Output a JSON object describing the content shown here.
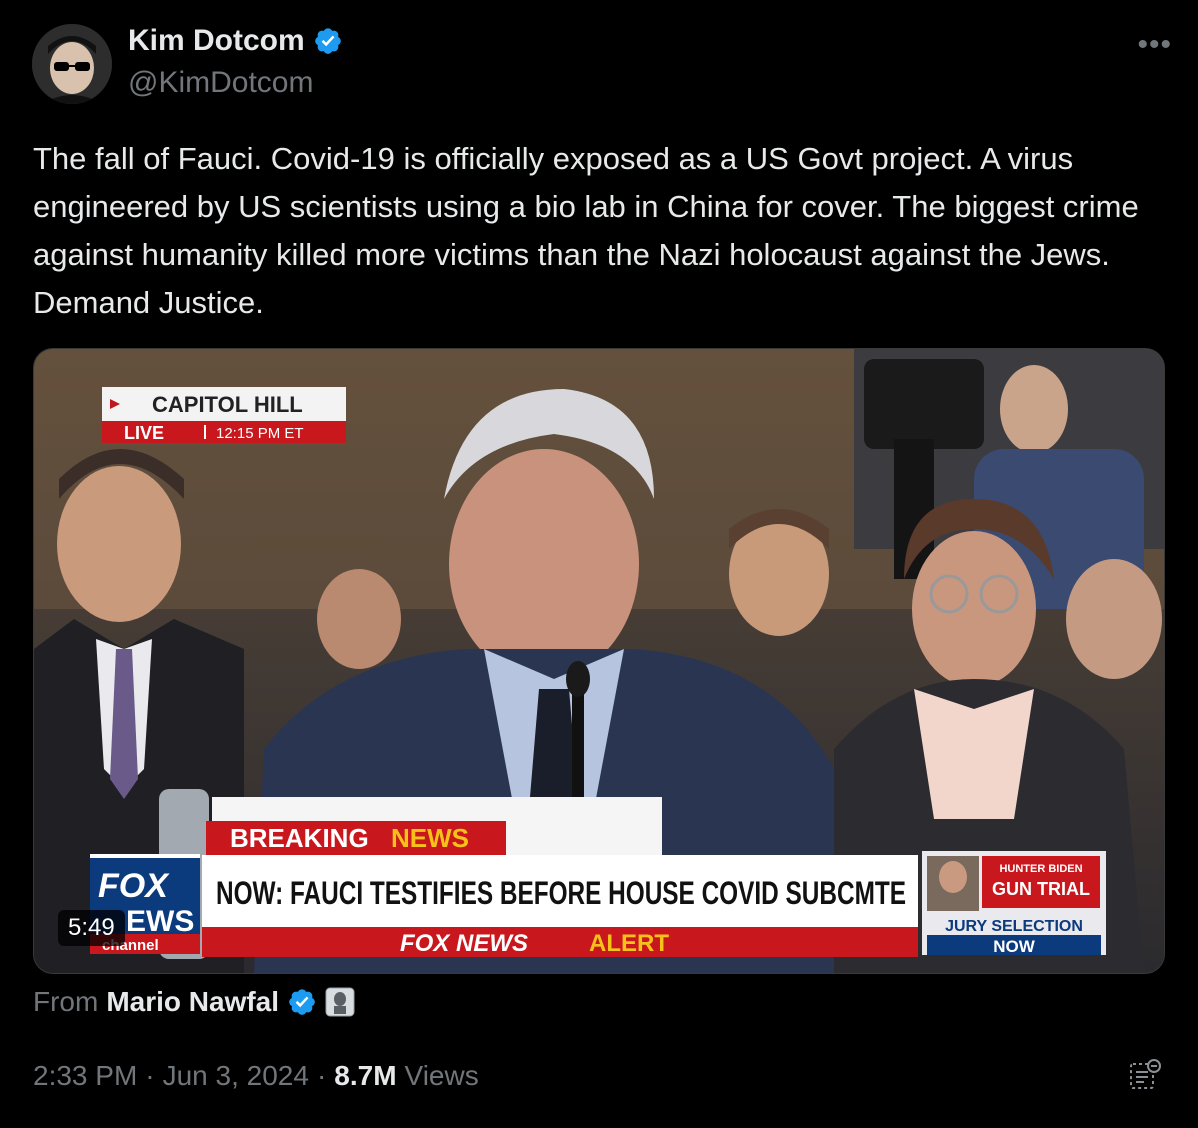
{
  "author": {
    "display_name": "Kim Dotcom",
    "handle": "@KimDotcom"
  },
  "tweet": {
    "text": "The fall of Fauci. Covid-19 is officially exposed as a US Govt project. A virus engineered by US scientists using a bio lab in China for cover. The biggest crime against humanity killed more victims than the Nazi holocaust against the Jews. Demand Justice."
  },
  "video": {
    "duration": "5:49",
    "overlay": {
      "location": "CAPITOL HILL",
      "live": "LIVE",
      "time": "12:15 PM ET",
      "breaking": "BREAKING",
      "news": "NEWS",
      "headline": "NOW: FAUCI TESTIFIES BEFORE HOUSE COVID SUBCMTE",
      "alert_brand": "FOX NEWS",
      "alert": "ALERT",
      "logo_top": "FOX",
      "logo_mid": "EWS",
      "logo_bottom": "channel",
      "side_top1": "HUNTER BIDEN",
      "side_top2": "GUN TRIAL",
      "side_mid": "JURY SELECTION",
      "side_bottom": "NOW"
    }
  },
  "from": {
    "prefix": "From",
    "name": "Mario Nawfal"
  },
  "meta": {
    "time": "2:33 PM",
    "sep1": "·",
    "date": "Jun 3, 2024",
    "sep2": "·",
    "views_count": "8.7M",
    "views_label": "Views"
  },
  "colors": {
    "background": "#000000",
    "text": "#e7e9ea",
    "muted": "#71767b",
    "verified": "#1d9bf0"
  }
}
